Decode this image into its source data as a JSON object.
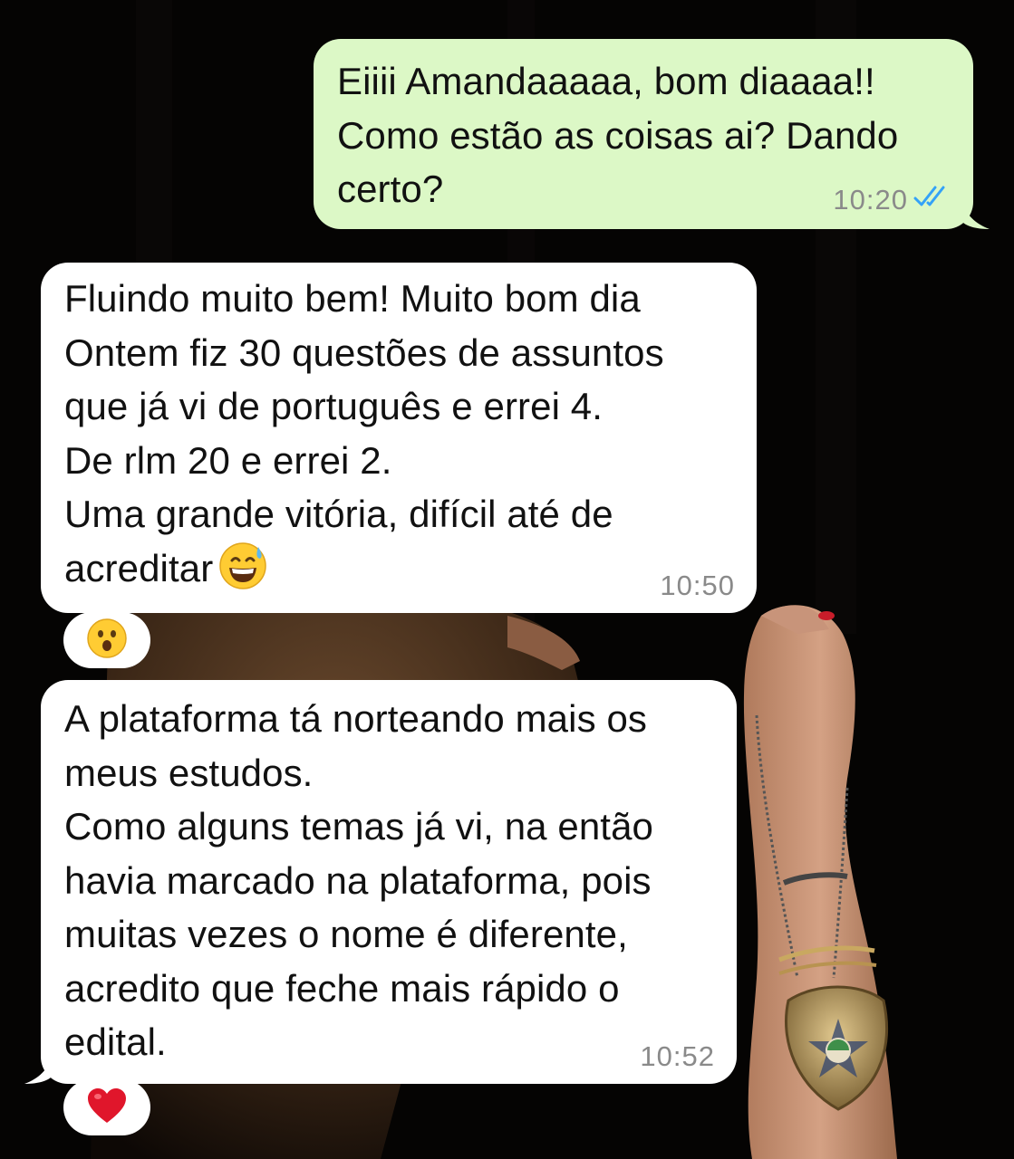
{
  "messages": [
    {
      "direction": "outgoing",
      "text": "Eiiii Amandaaaaa, bom diaaaa!!\nComo estão as coisas ai? Dando\ncerto?",
      "time": "10:20",
      "status_icon": "double-check-read-icon",
      "status_color": "#34a2f7"
    },
    {
      "direction": "incoming",
      "text": "Fluindo muito bem! Muito bom dia\nOntem fiz 30 questões de assuntos\nque já vi de português e errei 4.\nDe rlm 20 e errei 2.\nUma grande vitória, difícil até de\nacreditar",
      "trailing_emoji": "grinning-sweat-emoji",
      "time": "10:50",
      "reaction": "astonished-face-emoji"
    },
    {
      "direction": "incoming",
      "text": "A plataforma tá norteando mais os\nmeus estudos.\nComo alguns temas já vi, na então\nhavia marcado na plataforma, pois\nmuitas vezes o nome é diferente,\nacredito que feche mais rápido o\nedital.",
      "time": "10:52",
      "reaction": "red-heart-emoji"
    }
  ],
  "colors": {
    "outgoing_bubble": "#dcf8c6",
    "incoming_bubble": "#ffffff",
    "background": "#000000",
    "timestamp": "#8a8a8a"
  }
}
